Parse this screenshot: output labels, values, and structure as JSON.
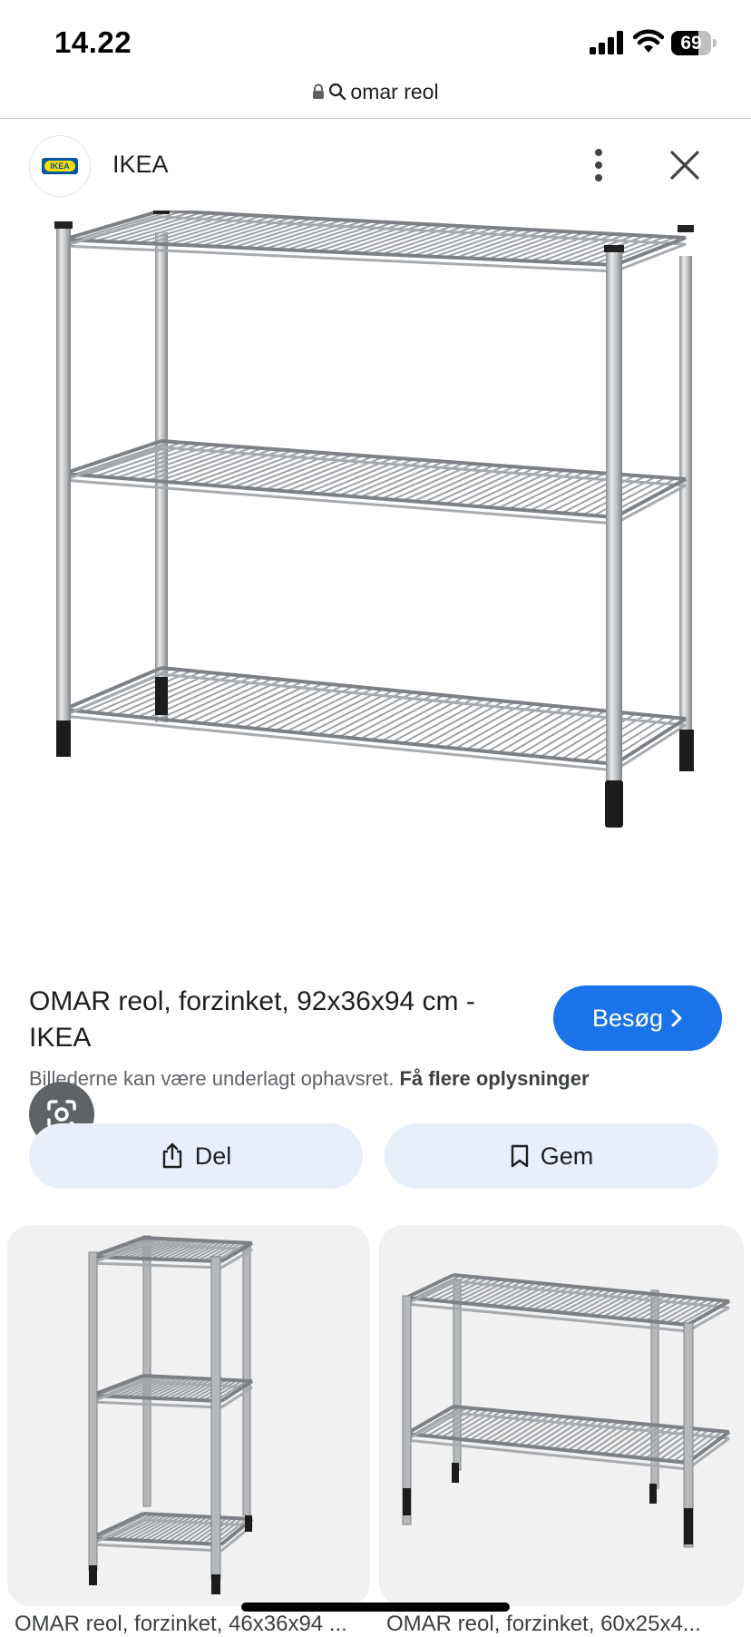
{
  "status_bar": {
    "time": "14.22",
    "battery_percent": "69",
    "battery_level": 0.69
  },
  "url_bar": {
    "query": "omar reol"
  },
  "source": {
    "name": "IKEA",
    "logo_text": "IKEA"
  },
  "main_image": {
    "alt": "OMAR reol, forzinket, 92x36x94 cm"
  },
  "result": {
    "title": "OMAR reol, forzinket, 92x36x94 cm - IKEA",
    "visit_label": "Besøg",
    "copyright_text": "Billederne kan være underlagt ophavsret.",
    "copyright_link": "Få flere oplysninger"
  },
  "actions": {
    "share_label": "Del",
    "save_label": "Gem"
  },
  "related": [
    {
      "caption": "OMAR reol, forzinket, 46x36x94 ..."
    },
    {
      "caption": "OMAR reol, forzinket, 60x25x4..."
    }
  ],
  "colors": {
    "accent": "#1a73e8",
    "action_bg": "#e8effb",
    "ikea_blue": "#0058a3",
    "ikea_yellow": "#ffdb00"
  }
}
